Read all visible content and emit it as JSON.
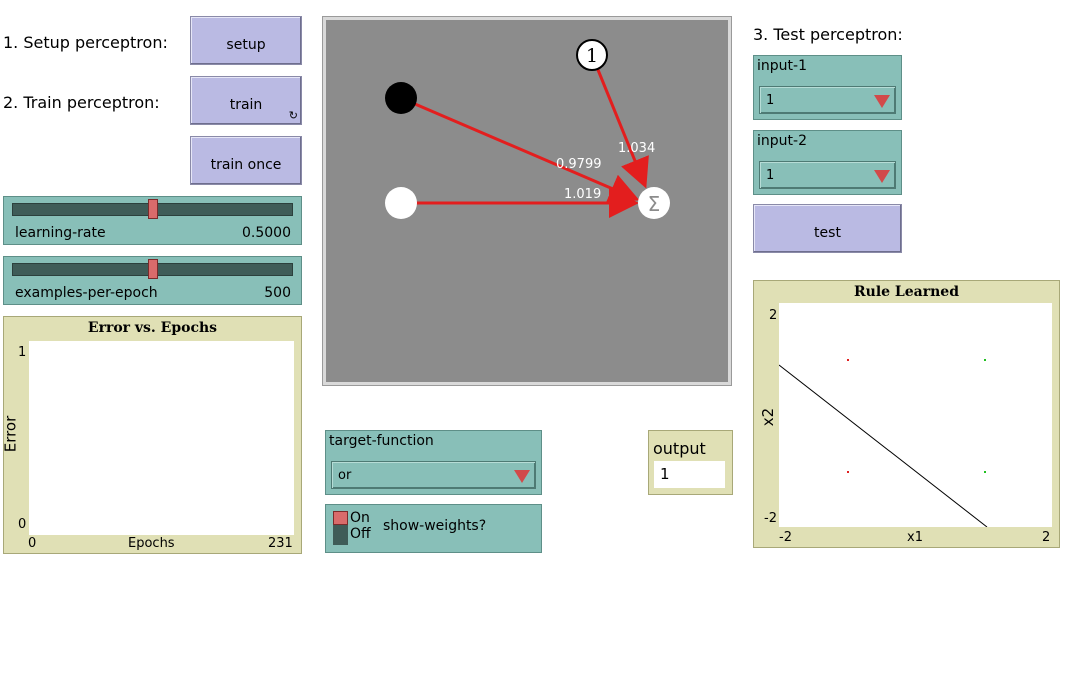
{
  "steps": {
    "setup_label": "1. Setup perceptron:",
    "train_label": "2. Train perceptron:",
    "test_label": "3. Test perceptron:"
  },
  "buttons": {
    "setup": "setup",
    "train": "train",
    "train_once": "train once",
    "test": "test"
  },
  "sliders": {
    "learning_rate": {
      "name": "learning-rate",
      "value": "0.5000",
      "fraction": 0.5
    },
    "examples_per_epoch": {
      "name": "examples-per-epoch",
      "value": "500",
      "fraction": 0.5
    }
  },
  "error_plot": {
    "title": "Error vs. Epochs",
    "ylabel": "Error",
    "xlabel": "Epochs",
    "ymax": "1",
    "ymin": "0",
    "xmin": "0",
    "xmax": "231"
  },
  "network_view": {
    "bias_label": "1",
    "sum_symbol": "Σ",
    "weights": {
      "input1": "0.9799",
      "input2": "1.019",
      "bias": "1.034"
    }
  },
  "target_function": {
    "name": "target-function",
    "value": "or"
  },
  "show_weights": {
    "on": "On",
    "off": "Off",
    "name": "show-weights?"
  },
  "output_monitor": {
    "name": "output",
    "value": "1"
  },
  "inputs": {
    "input1": {
      "name": "input-1",
      "value": "1"
    },
    "input2": {
      "name": "input-2",
      "value": "1"
    }
  },
  "rule_plot": {
    "title": "Rule Learned",
    "xlabel": "x1",
    "ylabel": "x2",
    "ymax": "2",
    "ymin": "-2",
    "xmin": "-2",
    "xmax": "2"
  },
  "colors": {
    "button": "#babae3",
    "widget": "#88bfb8",
    "plot_frame": "#e0e0b5",
    "view_bg": "#8c8c8c",
    "link": "#e31e1e"
  }
}
